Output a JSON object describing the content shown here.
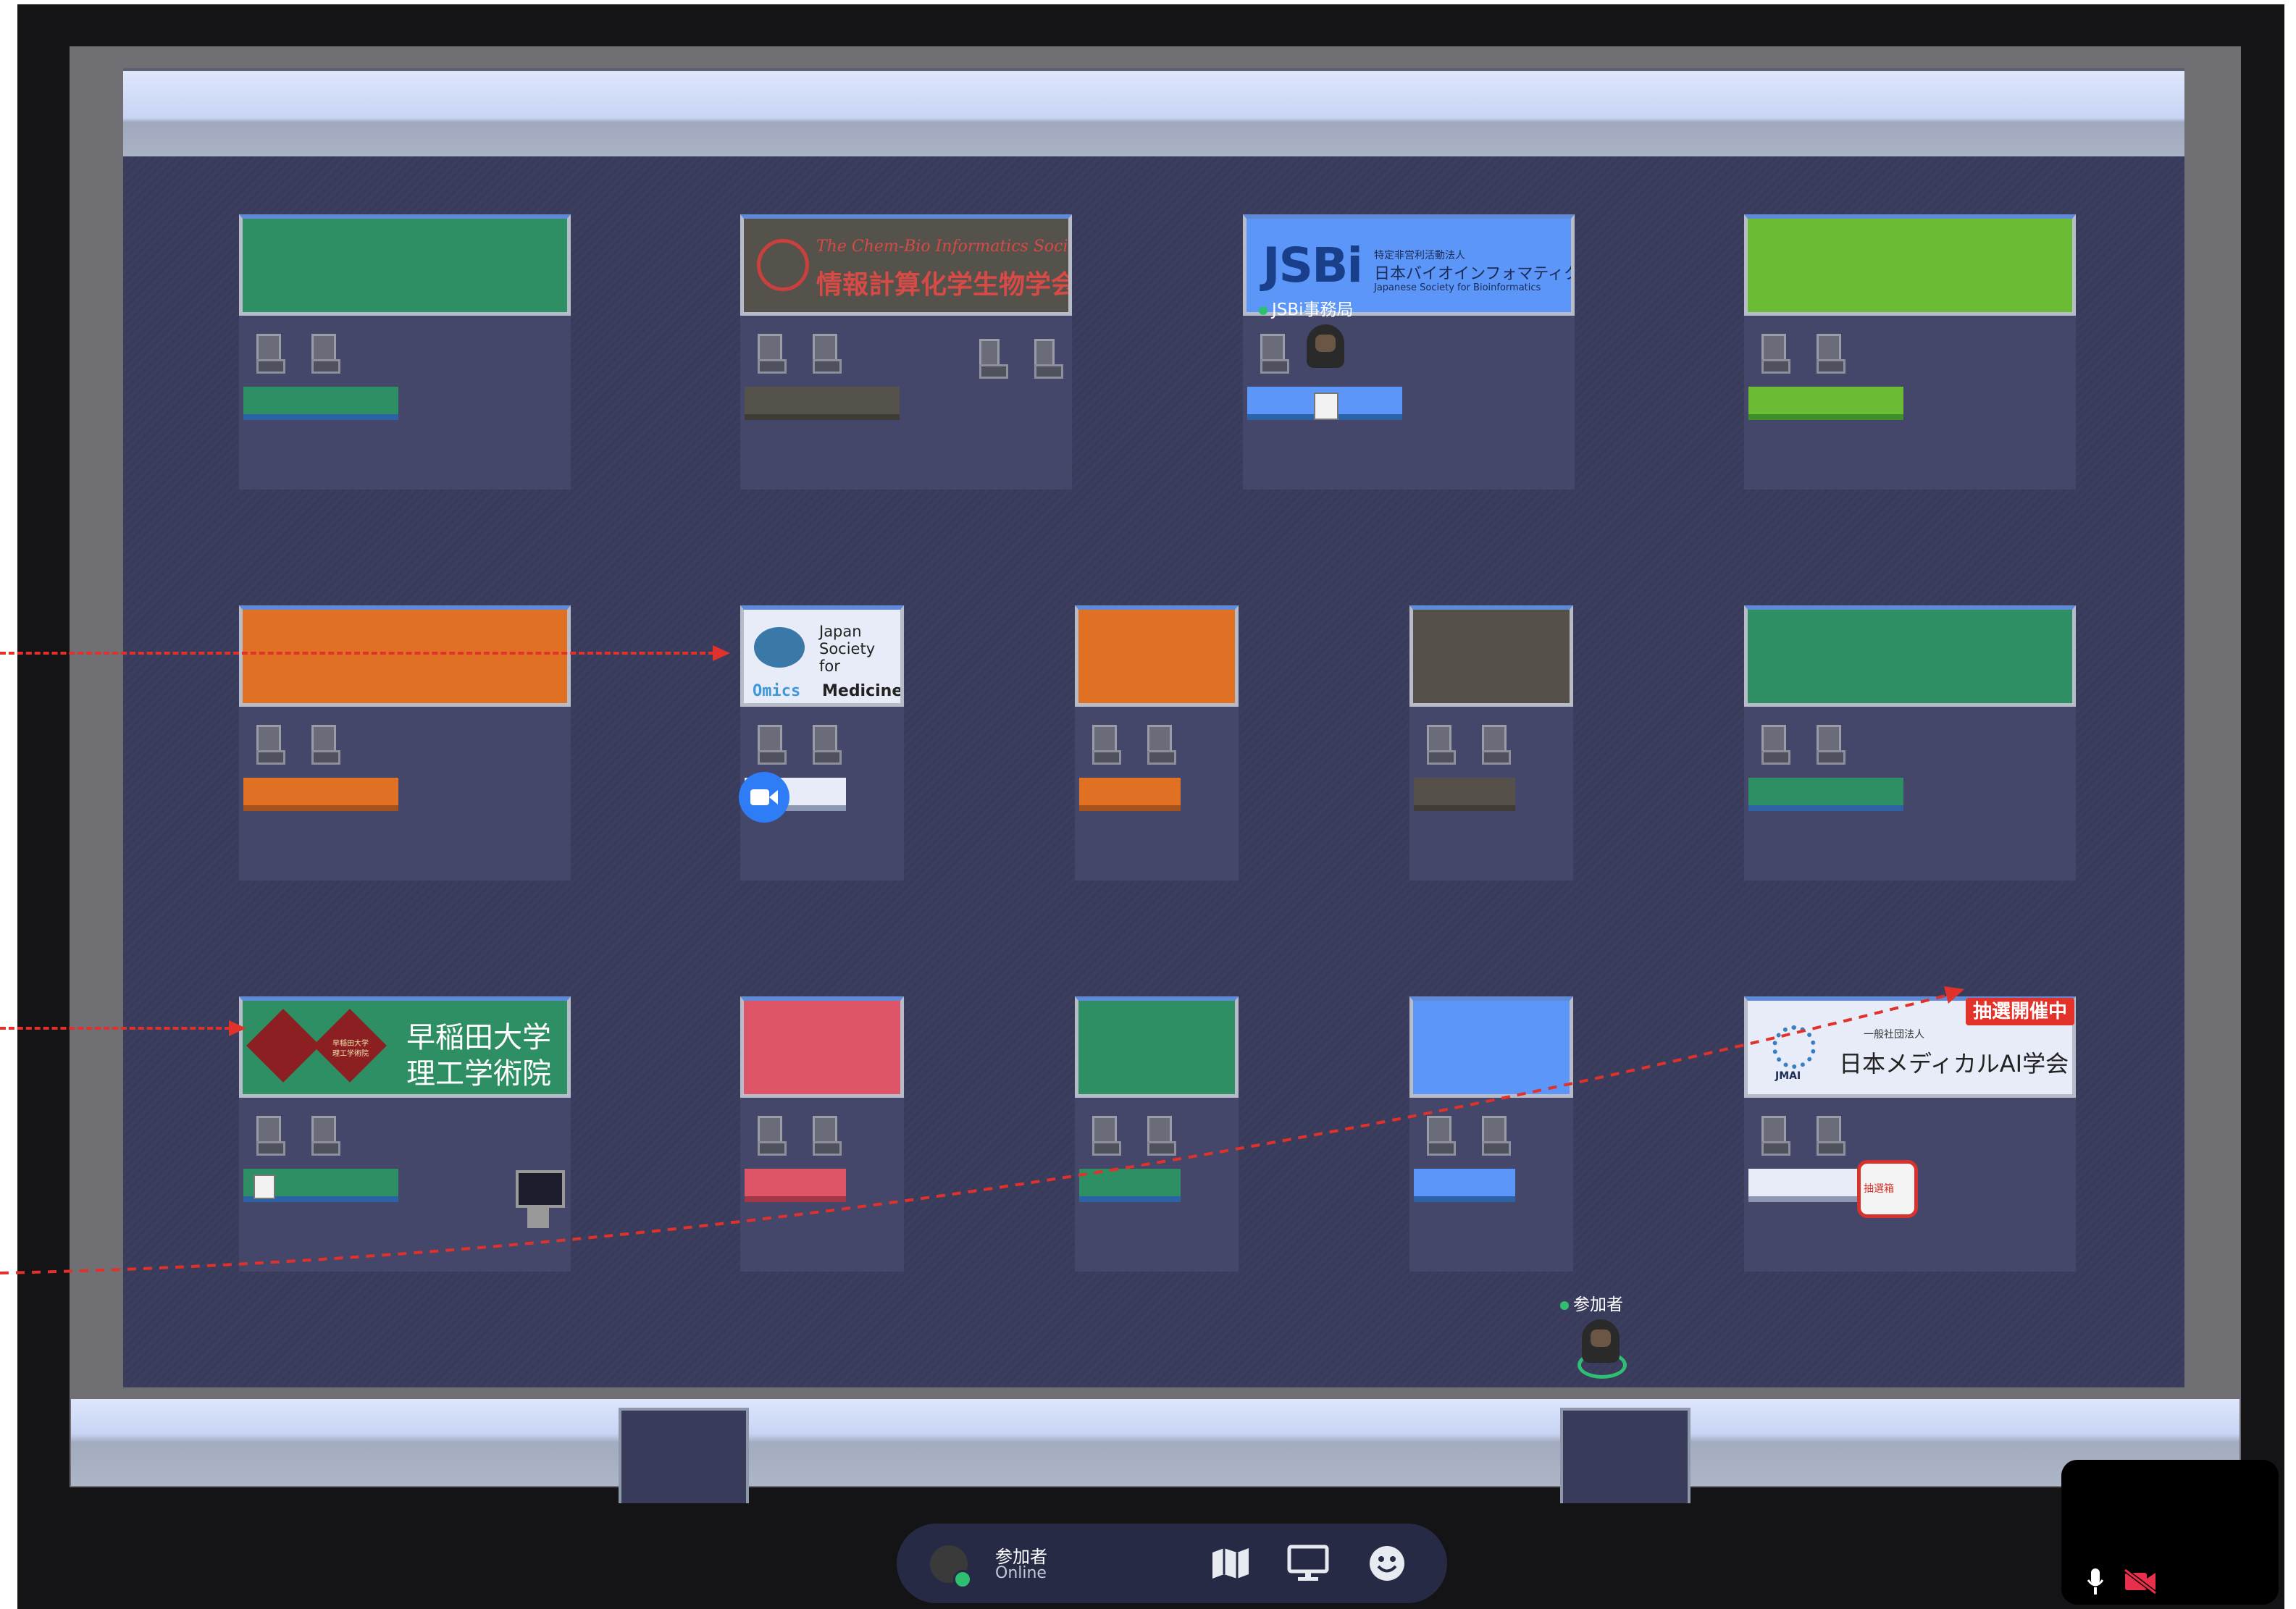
{
  "booths": {
    "isbi": {
      "line1": "The Chem-Bio Informatics Society",
      "line2": "情報計算化学生物学会"
    },
    "jsbi": {
      "logo": "JSBi",
      "line1": "特定非営利活動法人",
      "line2": "日本バイオインフォマティクス学会",
      "line3": "Japanese Society for Bioinformatics"
    },
    "jsom": {
      "line1": "Japan",
      "line2": "Society",
      "line3": "for",
      "line4a": "Omics",
      "line4b": "Medicine"
    },
    "waseda": {
      "small1": "早稲田大学",
      "small2": "理工学術院",
      "line1": "早稲田大学",
      "line2": "理工学術院"
    },
    "jmai": {
      "badge": "抽選開催中",
      "logo": "JMAI",
      "line1": "一般社団法人",
      "line2": "日本メディカルAI学会",
      "prize": "抽選箱"
    }
  },
  "participants": {
    "staff": {
      "name": "JSBi事務局"
    },
    "self": {
      "name": "参加者"
    }
  },
  "toolbar": {
    "name": "参加者",
    "status": "Online"
  },
  "colors": {
    "green": "#2f8f64",
    "orange": "#e07124",
    "lime": "#6bbb34",
    "blue": "#5b96f8",
    "red": "#dd5566",
    "gray": "#555049",
    "arrow": "#e0322b"
  }
}
